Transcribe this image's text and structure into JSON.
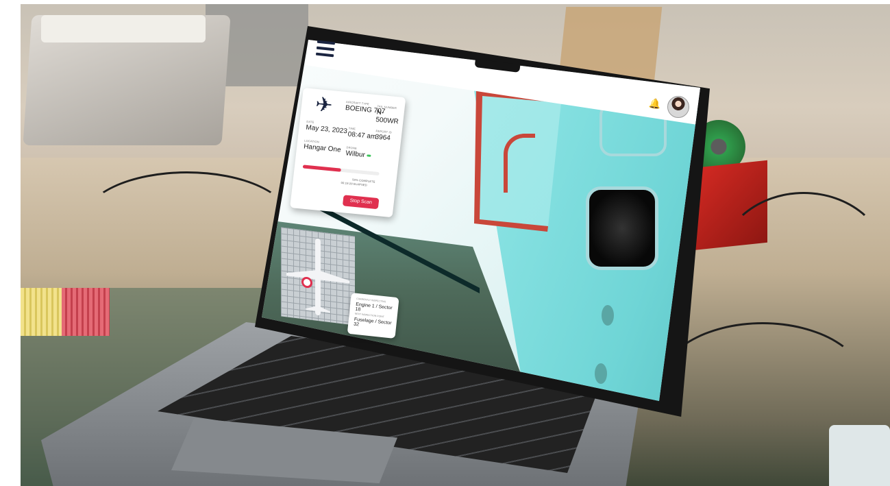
{
  "header": {
    "menu_icon": "menu-icon",
    "bell_icon": "bell-icon",
    "avatar_icon": "avatar"
  },
  "inspection": {
    "plane_icon": "airplane-icon",
    "aircraft_type_label": "AIRCRAFT TYPE",
    "aircraft_type": "BOEING 707",
    "tail_number_label": "TAIL NUMBER",
    "tail_number": "N-500WR",
    "date_label": "DATE",
    "date": "May 23, 2023",
    "time_label": "TIME",
    "time": "08:47 am",
    "report_id_label": "REPORT ID",
    "report_id": "3964",
    "location_label": "LOCATION",
    "location": "Hangar One",
    "drone_label": "DRONE",
    "drone": "Wilbur",
    "progress": 0.5,
    "percent_complete": "50% COMPLETE",
    "elapsed": "00:18:28 ELAPSED",
    "stop_button": "Stop Scan"
  },
  "map": {
    "current_label": "CURRENTLY INSPECTING",
    "current": "Engine 1 / Sector 18",
    "next_label": "NEXT INSPECTION POINT",
    "next": "Fuselage / Sector 32"
  },
  "colors": {
    "accent": "#e0304f",
    "nav": "#1a2440"
  }
}
